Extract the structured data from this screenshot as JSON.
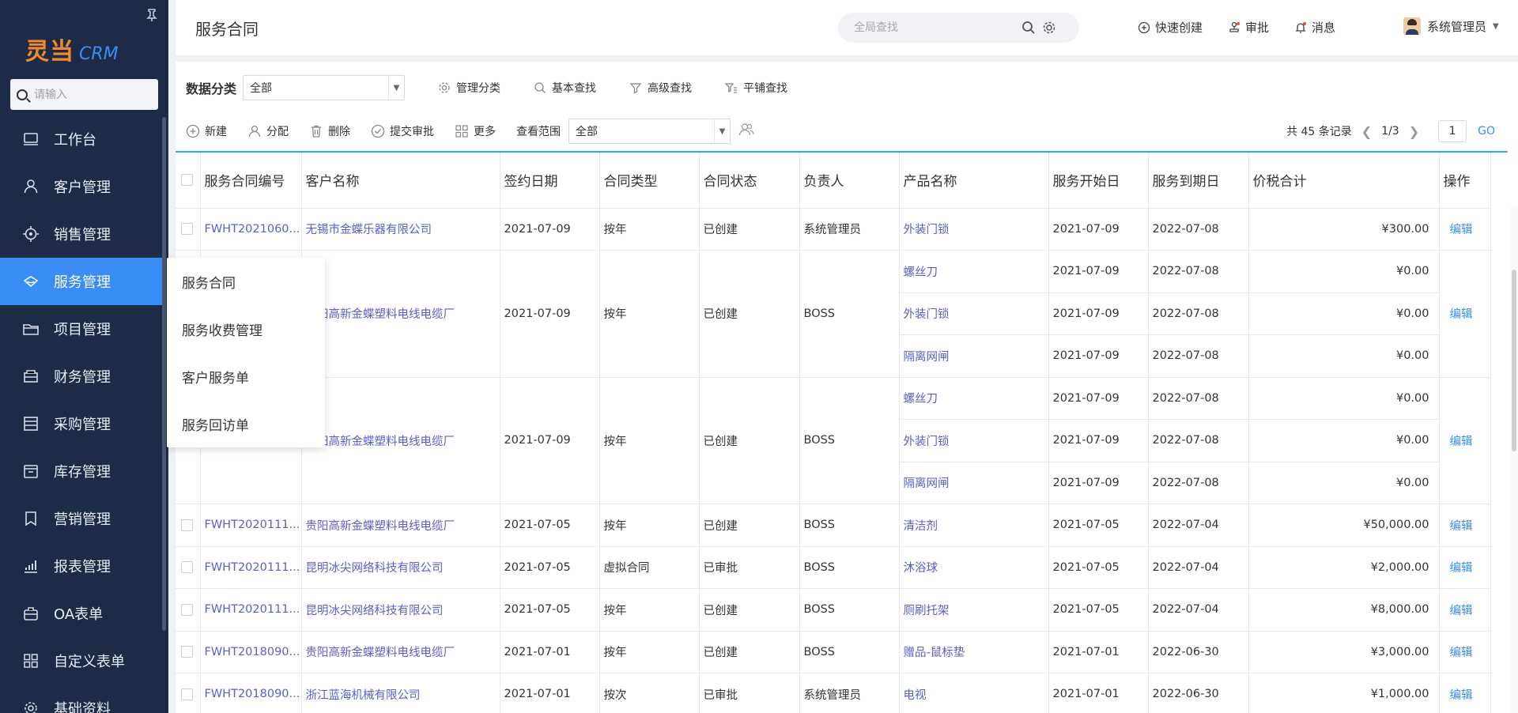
{
  "sidebar": {
    "logo_cn": "灵当",
    "logo_en": "CRM",
    "search_placeholder": "请输入",
    "items": [
      {
        "label": "工作台",
        "icon": "monitor-icon"
      },
      {
        "label": "客户管理",
        "icon": "user-icon"
      },
      {
        "label": "销售管理",
        "icon": "target-icon"
      },
      {
        "label": "服务管理",
        "icon": "service-icon",
        "active": true
      },
      {
        "label": "项目管理",
        "icon": "folder-icon"
      },
      {
        "label": "财务管理",
        "icon": "finance-icon"
      },
      {
        "label": "采购管理",
        "icon": "purchase-icon"
      },
      {
        "label": "库存管理",
        "icon": "inventory-icon"
      },
      {
        "label": "营销管理",
        "icon": "bookmark-icon"
      },
      {
        "label": "报表管理",
        "icon": "chart-icon"
      },
      {
        "label": "OA表单",
        "icon": "briefcase-icon"
      },
      {
        "label": "自定义表单",
        "icon": "grid-icon"
      },
      {
        "label": "基础资料",
        "icon": "settings-icon"
      }
    ]
  },
  "submenu": {
    "items": [
      "服务合同",
      "服务收费管理",
      "客户服务单",
      "服务回访单"
    ]
  },
  "header": {
    "title": "服务合同",
    "search_placeholder": "全局查找",
    "quick_create": "快速创建",
    "approve": "审批",
    "messages": "消息",
    "user_name": "系统管理员"
  },
  "filters": {
    "label": "数据分类",
    "category_value": "全部",
    "manage_category": "管理分类",
    "basic_search": "基本查找",
    "advanced_search": "高级查找",
    "flat_search": "平铺查找"
  },
  "toolbar": {
    "new": "新建",
    "assign": "分配",
    "delete": "删除",
    "submit_approval": "提交审批",
    "more": "更多",
    "range_label": "查看范围",
    "range_value": "全部",
    "total": "共 45 条记录",
    "page": "1/3",
    "page_input": "1",
    "go": "GO"
  },
  "table": {
    "columns": [
      "服务合同编号",
      "客户名称",
      "签约日期",
      "合同类型",
      "合同状态",
      "负责人",
      "产品名称",
      "服务开始日",
      "服务到期日",
      "价税合计",
      "操作"
    ],
    "edit_label": "编辑",
    "groups": [
      {
        "code": "FWHT2021060...",
        "customer": "无锡市金蝶乐器有限公司",
        "sign_date": "2021-07-09",
        "type": "按年",
        "status": "已创建",
        "owner": "系统管理员",
        "products": [
          {
            "name": "外装门锁",
            "start": "2021-07-09",
            "end": "2022-07-08",
            "amount": "¥300.00"
          }
        ]
      },
      {
        "code": "",
        "customer": "贵阳高新金蝶塑料电线电缆厂",
        "sign_date": "2021-07-09",
        "type": "按年",
        "status": "已创建",
        "owner": "BOSS",
        "products": [
          {
            "name": "螺丝刀",
            "start": "2021-07-09",
            "end": "2022-07-08",
            "amount": "¥0.00"
          },
          {
            "name": "外装门锁",
            "start": "2021-07-09",
            "end": "2022-07-08",
            "amount": "¥0.00"
          },
          {
            "name": "隔离网闸",
            "start": "2021-07-09",
            "end": "2022-07-08",
            "amount": "¥0.00"
          }
        ]
      },
      {
        "code": "",
        "customer": "贵阳高新金蝶塑料电线电缆厂",
        "sign_date": "2021-07-09",
        "type": "按年",
        "status": "已创建",
        "owner": "BOSS",
        "products": [
          {
            "name": "螺丝刀",
            "start": "2021-07-09",
            "end": "2022-07-08",
            "amount": "¥0.00"
          },
          {
            "name": "外装门锁",
            "start": "2021-07-09",
            "end": "2022-07-08",
            "amount": "¥0.00"
          },
          {
            "name": "隔离网闸",
            "start": "2021-07-09",
            "end": "2022-07-08",
            "amount": "¥0.00"
          }
        ]
      },
      {
        "code": "FWHT2020111...",
        "customer": "贵阳高新金蝶塑料电线电缆厂",
        "sign_date": "2021-07-05",
        "type": "按年",
        "status": "已创建",
        "owner": "BOSS",
        "products": [
          {
            "name": "清洁剂",
            "start": "2021-07-05",
            "end": "2022-07-04",
            "amount": "¥50,000.00"
          }
        ]
      },
      {
        "code": "FWHT2020111...",
        "customer": "昆明冰尖网络科技有限公司",
        "sign_date": "2021-07-05",
        "type": "虚拟合同",
        "status": "已审批",
        "owner": "BOSS",
        "products": [
          {
            "name": "沐浴球",
            "start": "2021-07-05",
            "end": "2022-07-04",
            "amount": "¥2,000.00"
          }
        ]
      },
      {
        "code": "FWHT2020111...",
        "customer": "昆明冰尖网络科技有限公司",
        "sign_date": "2021-07-05",
        "type": "按年",
        "status": "已创建",
        "owner": "BOSS",
        "products": [
          {
            "name": "厕刷托架",
            "start": "2021-07-05",
            "end": "2022-07-04",
            "amount": "¥8,000.00"
          }
        ]
      },
      {
        "code": "FWHT2018090...",
        "customer": "贵阳高新金蝶塑料电线电缆厂",
        "sign_date": "2021-07-01",
        "type": "按年",
        "status": "已创建",
        "owner": "BOSS",
        "products": [
          {
            "name": "赠品-鼠标垫",
            "start": "2021-07-01",
            "end": "2022-06-30",
            "amount": "¥3,000.00"
          }
        ]
      },
      {
        "code": "FWHT2018090...",
        "customer": "浙江蓝海机械有限公司",
        "sign_date": "2021-07-01",
        "type": "按次",
        "status": "已审批",
        "owner": "系统管理员",
        "products": [
          {
            "name": "电视",
            "start": "2021-07-01",
            "end": "2022-06-30",
            "amount": "¥1,000.00"
          }
        ]
      }
    ]
  },
  "colors": {
    "sidebar_bg": "#1e2b47",
    "active": "#3a8df5",
    "logo": "#f08a2c",
    "link": "#5a5fc7",
    "accent_line": "#2bb5b0"
  }
}
